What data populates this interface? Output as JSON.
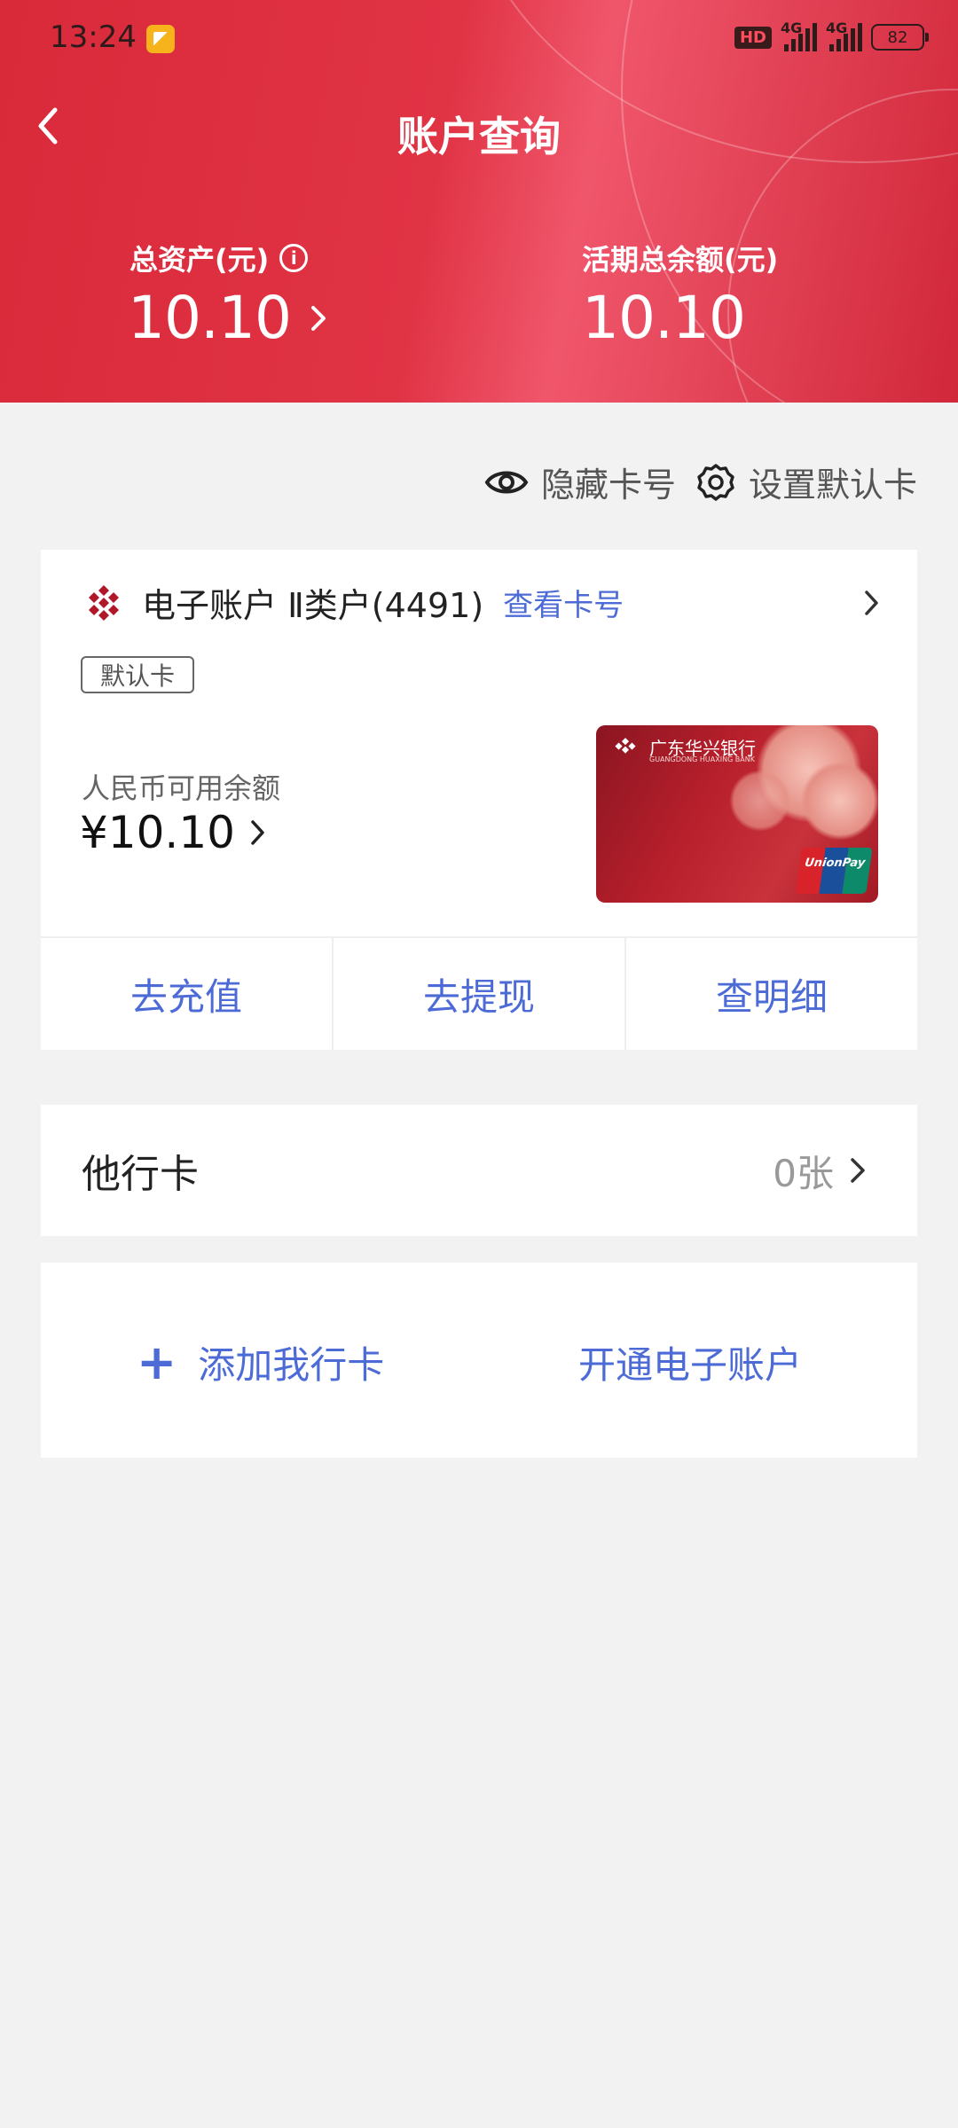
{
  "status_bar": {
    "time": "13:24",
    "hd_label": "HD",
    "network1": "4G",
    "network2": "4G",
    "battery": "82"
  },
  "header": {
    "title": "账户查询",
    "total_assets_label": "总资产(元)",
    "total_assets_value": "10.10",
    "current_balance_label": "活期总余额(元)",
    "current_balance_value": "10.10",
    "gradient_color": "#e03344"
  },
  "toolbar": {
    "hide_card_label": "隐藏卡号",
    "set_default_label": "设置默认卡"
  },
  "account_card": {
    "account_name": "电子账户 Ⅱ类户(4491)",
    "view_number_label": "查看卡号",
    "default_badge": "默认卡",
    "rmb_label": "人民币可用余额",
    "rmb_value": "¥10.10",
    "card_bank_name": "广东华兴银行",
    "card_bank_sub": "GUANGDONG HUAXING BANK",
    "card_network": "UnionPay",
    "actions": [
      "去充值",
      "去提现",
      "查明细"
    ]
  },
  "other_bank": {
    "label": "他行卡",
    "count": "0张"
  },
  "bottom_actions": {
    "add_card": "添加我行卡",
    "open_account": "开通电子账户"
  },
  "colors": {
    "accent_blue": "#4d6bd6",
    "brand_red": "#d92a3a"
  }
}
